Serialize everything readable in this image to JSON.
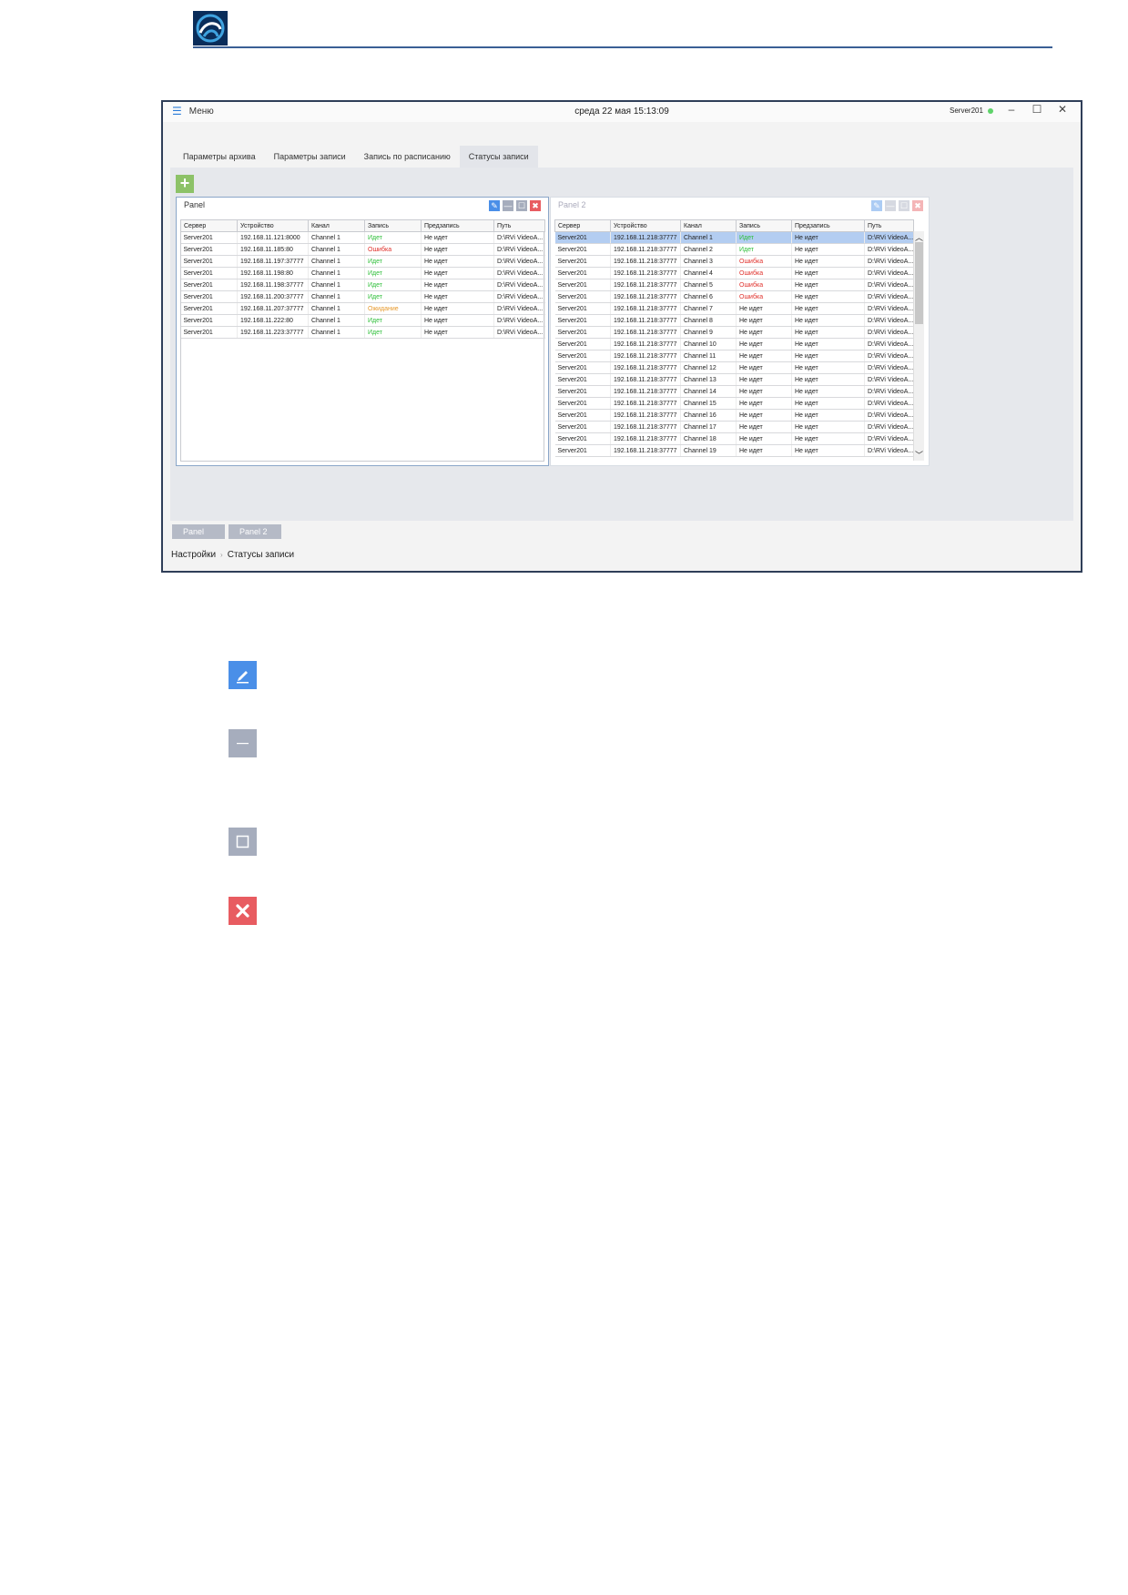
{
  "titlebar": {
    "menu_label": "Меню",
    "clock": "среда 22 мая 15:13:09",
    "server": "Server201"
  },
  "tabs": [
    {
      "label": "Параметры архива"
    },
    {
      "label": "Параметры записи"
    },
    {
      "label": "Запись по расписанию"
    },
    {
      "label": "Статусы записи"
    }
  ],
  "columns": [
    "Сервер",
    "Устройство",
    "Канал",
    "Запись",
    "Предзапись",
    "Путь"
  ],
  "panel1": {
    "title": "Panel",
    "rows": [
      [
        "Server201",
        "192.168.11.121:8000",
        "Channel 1",
        "Идет",
        "Не идет",
        "D:\\RVi VideoA..."
      ],
      [
        "Server201",
        "192.168.11.185:80",
        "Channel 1",
        "Ошибка",
        "Не идет",
        "D:\\RVi VideoA..."
      ],
      [
        "Server201",
        "192.168.11.197:37777",
        "Channel 1",
        "Идет",
        "Не идет",
        "D:\\RVi VideoA..."
      ],
      [
        "Server201",
        "192.168.11.198:80",
        "Channel 1",
        "Идет",
        "Не идет",
        "D:\\RVi VideoA..."
      ],
      [
        "Server201",
        "192.168.11.198:37777",
        "Channel 1",
        "Идет",
        "Не идет",
        "D:\\RVi VideoA..."
      ],
      [
        "Server201",
        "192.168.11.200:37777",
        "Channel 1",
        "Идет",
        "Не идет",
        "D:\\RVi VideoA..."
      ],
      [
        "Server201",
        "192.168.11.207:37777",
        "Channel 1",
        "Ожидание",
        "Не идет",
        "D:\\RVi VideoA..."
      ],
      [
        "Server201",
        "192.168.11.222:80",
        "Channel 1",
        "Идет",
        "Не идет",
        "D:\\RVi VideoA..."
      ],
      [
        "Server201",
        "192.168.11.223:37777",
        "Channel 1",
        "Идет",
        "Не идет",
        "D:\\RVi VideoA..."
      ]
    ]
  },
  "panel2": {
    "title": "Panel 2",
    "rows": [
      [
        "Server201",
        "192.168.11.218:37777",
        "Channel 1",
        "Идет",
        "Не идет",
        "D:\\RVi VideoA..."
      ],
      [
        "Server201",
        "192.168.11.218:37777",
        "Channel 2",
        "Идет",
        "Не идет",
        "D:\\RVi VideoA..."
      ],
      [
        "Server201",
        "192.168.11.218:37777",
        "Channel 3",
        "Ошибка",
        "Не идет",
        "D:\\RVi VideoA..."
      ],
      [
        "Server201",
        "192.168.11.218:37777",
        "Channel 4",
        "Ошибка",
        "Не идет",
        "D:\\RVi VideoA..."
      ],
      [
        "Server201",
        "192.168.11.218:37777",
        "Channel 5",
        "Ошибка",
        "Не идет",
        "D:\\RVi VideoA..."
      ],
      [
        "Server201",
        "192.168.11.218:37777",
        "Channel 6",
        "Ошибка",
        "Не идет",
        "D:\\RVi VideoA..."
      ],
      [
        "Server201",
        "192.168.11.218:37777",
        "Channel 7",
        "Не идет",
        "Не идет",
        "D:\\RVi VideoA..."
      ],
      [
        "Server201",
        "192.168.11.218:37777",
        "Channel 8",
        "Не идет",
        "Не идет",
        "D:\\RVi VideoA..."
      ],
      [
        "Server201",
        "192.168.11.218:37777",
        "Channel 9",
        "Не идет",
        "Не идет",
        "D:\\RVi VideoA..."
      ],
      [
        "Server201",
        "192.168.11.218:37777",
        "Channel 10",
        "Не идет",
        "Не идет",
        "D:\\RVi VideoA..."
      ],
      [
        "Server201",
        "192.168.11.218:37777",
        "Channel 11",
        "Не идет",
        "Не идет",
        "D:\\RVi VideoA..."
      ],
      [
        "Server201",
        "192.168.11.218:37777",
        "Channel 12",
        "Не идет",
        "Не идет",
        "D:\\RVi VideoA..."
      ],
      [
        "Server201",
        "192.168.11.218:37777",
        "Channel 13",
        "Не идет",
        "Не идет",
        "D:\\RVi VideoA..."
      ],
      [
        "Server201",
        "192.168.11.218:37777",
        "Channel 14",
        "Не идет",
        "Не идет",
        "D:\\RVi VideoA..."
      ],
      [
        "Server201",
        "192.168.11.218:37777",
        "Channel 15",
        "Не идет",
        "Не идет",
        "D:\\RVi VideoA..."
      ],
      [
        "Server201",
        "192.168.11.218:37777",
        "Channel 16",
        "Не идет",
        "Не идет",
        "D:\\RVi VideoA..."
      ],
      [
        "Server201",
        "192.168.11.218:37777",
        "Channel 17",
        "Не идет",
        "Не идет",
        "D:\\RVi VideoA..."
      ],
      [
        "Server201",
        "192.168.11.218:37777",
        "Channel 18",
        "Не идет",
        "Не идет",
        "D:\\RVi VideoA..."
      ],
      [
        "Server201",
        "192.168.11.218:37777",
        "Channel 19",
        "Не идет",
        "Не идет",
        "D:\\RVi VideoA..."
      ]
    ]
  },
  "bottom_tabs": [
    {
      "label": "Panel"
    },
    {
      "label": "Panel 2"
    }
  ],
  "breadcrumb": {
    "root": "Настройки",
    "current": "Статусы записи"
  },
  "status_colors": {
    "Идет": "#2fbf3a",
    "Ошибка": "#e0312c",
    "Ожидание": "#e79a2d"
  },
  "legend_icons": [
    {
      "name": "edit-icon",
      "color": "#4a8fe8"
    },
    {
      "name": "minimize-icon",
      "color": "#a6adbd"
    },
    {
      "name": "maximize-icon",
      "color": "#a6adbd"
    },
    {
      "name": "close-icon",
      "color": "#e85c61"
    }
  ]
}
